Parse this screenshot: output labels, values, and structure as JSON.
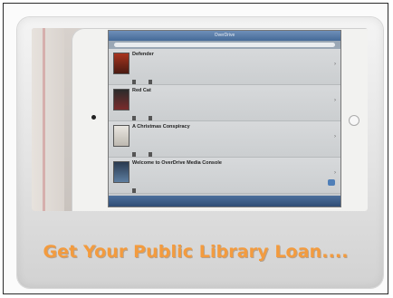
{
  "slide": {
    "headline": "Get Your Public Library Loan....",
    "headline_color": "#f39b3e"
  },
  "device": {
    "app_title": "OverDrive",
    "nav_left": "",
    "nav_right": "",
    "books": [
      {
        "author": "",
        "title": "Defender",
        "subtitle": "",
        "format": "",
        "cover_icon": "book-cover-icon",
        "cover_style": "c0"
      },
      {
        "author": "",
        "title": "Red Cat",
        "subtitle": "",
        "format": "",
        "cover_icon": "book-cover-icon",
        "cover_style": "c1"
      },
      {
        "author": "",
        "title": "A Christmas Conspiracy",
        "subtitle": "",
        "format": "",
        "cover_icon": "book-cover-icon",
        "cover_style": "c2"
      },
      {
        "author": "",
        "title": "Welcome to OverDrive Media Console",
        "subtitle": "",
        "format": "",
        "cover_icon": "book-cover-icon",
        "cover_style": "c3"
      }
    ],
    "tabbar_items": [
      "",
      "",
      ""
    ]
  }
}
